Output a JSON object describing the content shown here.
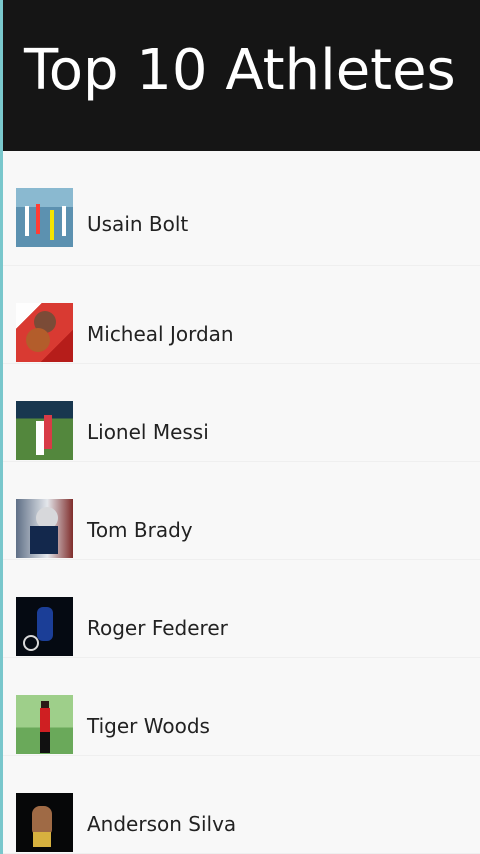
{
  "header": {
    "title": "Top 10 Athletes",
    "background": "#151515",
    "text_color": "#ffffff"
  },
  "list": {
    "items": [
      {
        "name": "Usain Bolt",
        "thumbnail": "athlete-photo-icon"
      },
      {
        "name": "Micheal Jordan",
        "thumbnail": "athlete-photo-icon"
      },
      {
        "name": "Lionel Messi",
        "thumbnail": "athlete-photo-icon"
      },
      {
        "name": "Tom Brady",
        "thumbnail": "athlete-photo-icon"
      },
      {
        "name": "Roger Federer",
        "thumbnail": "athlete-photo-icon"
      },
      {
        "name": "Tiger Woods",
        "thumbnail": "athlete-photo-icon"
      },
      {
        "name": "Anderson Silva",
        "thumbnail": "athlete-photo-icon"
      }
    ]
  }
}
